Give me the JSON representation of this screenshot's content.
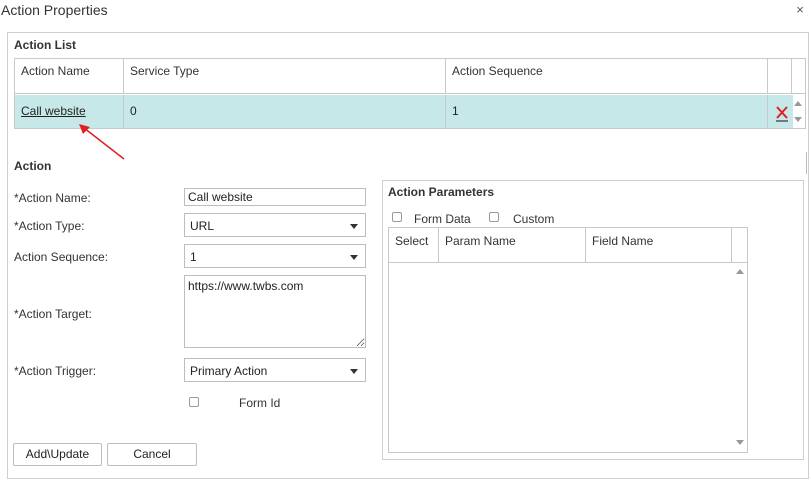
{
  "dialog": {
    "title": "Action Properties",
    "close_glyph": "×"
  },
  "action_list": {
    "heading": "Action List",
    "columns": [
      "Action Name",
      "Service Type",
      "Action Sequence"
    ],
    "rows": [
      {
        "action_name": "Call website",
        "service_type": "0",
        "action_sequence": "1"
      }
    ],
    "delete_icon": "delete-x-icon"
  },
  "action": {
    "heading": "Action",
    "name_label": "*Action Name:",
    "name_value": "Call website",
    "type_label": "*Action Type:",
    "type_value": "URL",
    "sequence_label": "Action Sequence:",
    "sequence_value": "1",
    "target_label": "*Action Target:",
    "target_value": "https://www.twbs.com",
    "trigger_label": "*Action Trigger:",
    "trigger_value": "Primary Action",
    "form_id_label": "Form Id"
  },
  "parameters": {
    "heading": "Action Parameters",
    "form_data_label": "Form Data",
    "custom_label": "Custom",
    "columns": [
      "Select",
      "Param Name",
      "Field Name"
    ]
  },
  "buttons": {
    "add_update": "Add\\Update",
    "cancel": "Cancel"
  },
  "colors": {
    "selected_row": "#c6e8e8",
    "link": "#1a4f8a",
    "delete_red": "#e02020",
    "annotation_arrow": "#e02020"
  }
}
